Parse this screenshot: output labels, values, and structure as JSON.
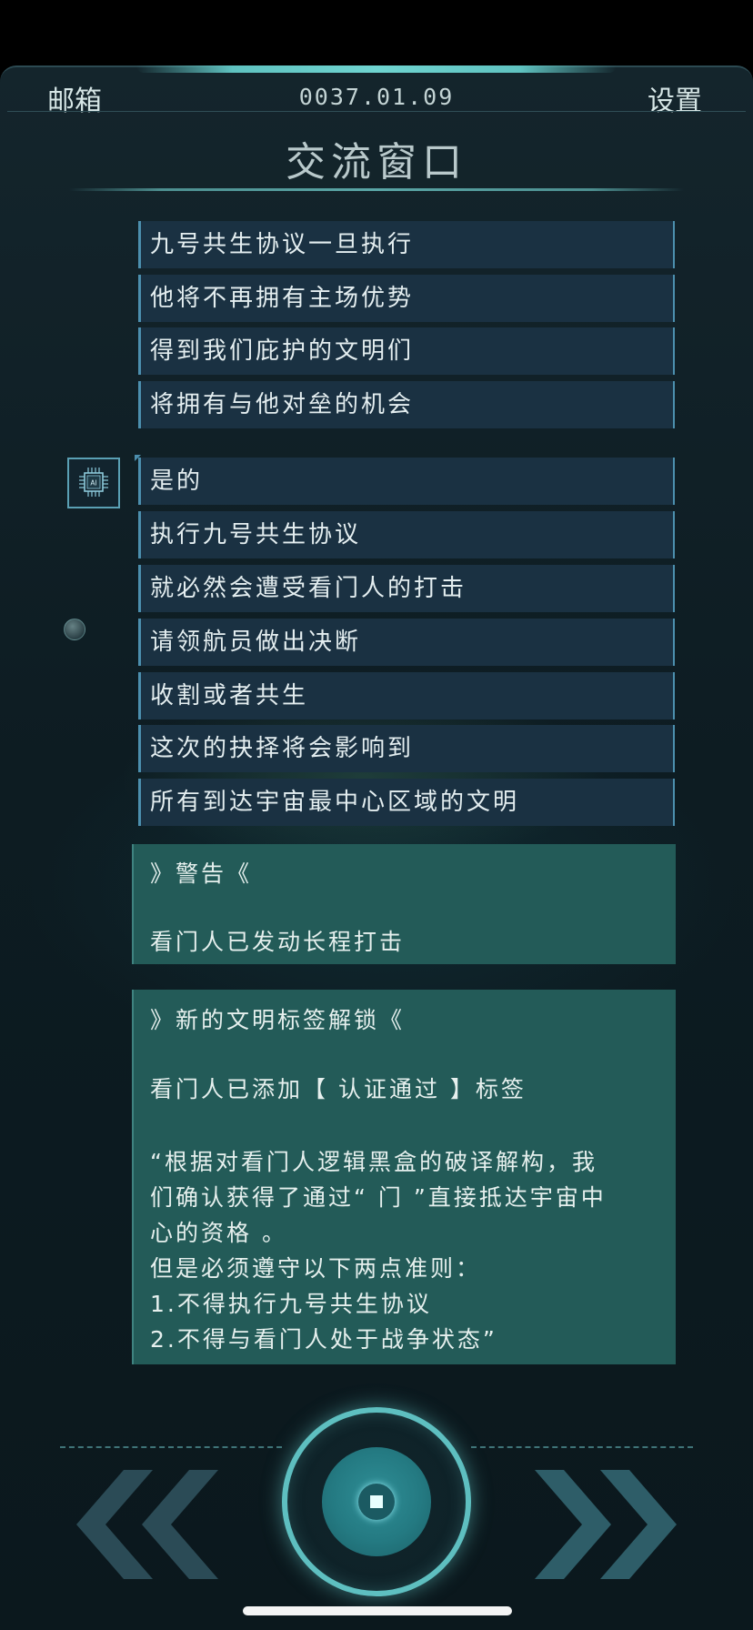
{
  "header": {
    "mail_label": "邮箱",
    "date": "0037.01.09",
    "settings_label": "设置",
    "title": "交流窗口"
  },
  "incoming_messages": [
    "九号共生协议一旦执行",
    "他将不再拥有主场优势",
    "得到我们庇护的文明们",
    "将拥有与他对垒的机会"
  ],
  "ai_avatar": {
    "icon": "ai-chip-icon",
    "label": "AI"
  },
  "ai_messages": [
    "是的",
    "执行九号共生协议",
    "就必然会遭受看门人的打击",
    "请领航员做出决断",
    "收割或者共生",
    "这次的抉择将会影响到",
    "所有到达宇宙最中心区域的文明"
  ],
  "warning_card": {
    "title": "》警告《",
    "body": "看门人已发动长程打击"
  },
  "unlock_card": {
    "title": "》新的文明标签解锁《",
    "line1": "看门人已添加【 认证通过 】标签",
    "quote_lines": [
      "“根据对看门人逻辑黑盒的破译解构，我",
      "们确认获得了通过“ 门 ”直接抵达宇宙中",
      "心的资格 。",
      "但是必须遵守以下两点准则：",
      "1.不得执行九号共生协议",
      "2.不得与看门人处于战争状态”"
    ]
  },
  "nav": {
    "prev_icon": "double-chevron-left-icon",
    "next_icon": "double-chevron-right-icon",
    "home_icon": "home-circle-icon"
  },
  "colors": {
    "accent": "#5ebfc0",
    "message_bg": "#1a3142",
    "message_border": "#4c8fae",
    "card_bg": "#235b58"
  }
}
